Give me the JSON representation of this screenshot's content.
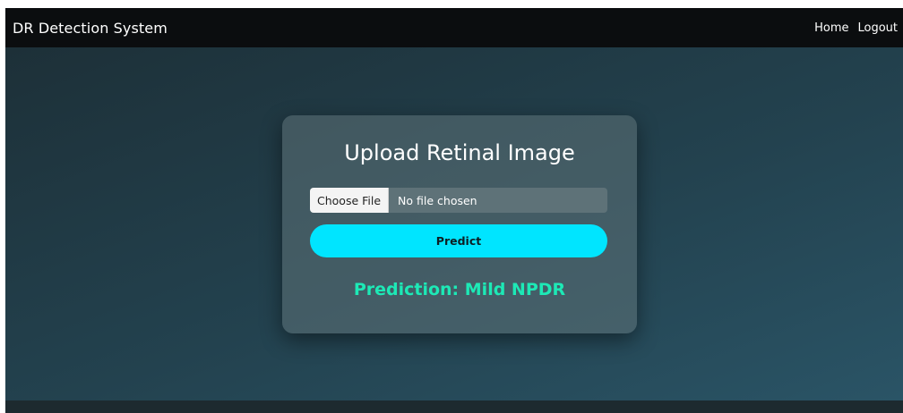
{
  "navbar": {
    "brand": "DR Detection System",
    "links": [
      "Home",
      "Logout"
    ]
  },
  "card": {
    "title": "Upload Retinal Image",
    "file_input": {
      "button_label": "Choose File",
      "status": "No file chosen"
    },
    "predict_label": "Predict",
    "prediction_text": "Prediction: Mild NPDR"
  },
  "colors": {
    "navbar_bg": "#0b0d0f",
    "accent_button": "#00e5ff",
    "prediction_text": "#1de9b6"
  }
}
